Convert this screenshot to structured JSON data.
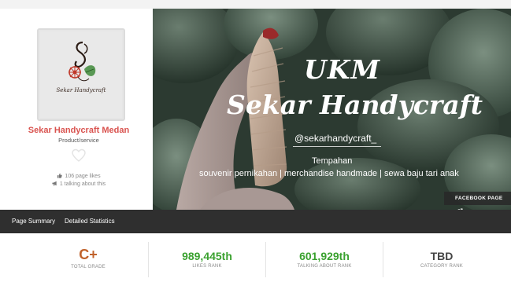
{
  "profile": {
    "logo_text": "Sekar Handycraft",
    "name": "Sekar Handycraft Medan",
    "category": "Product/service",
    "page_likes": "106 page likes",
    "talking_about": "1 talking about this"
  },
  "cover": {
    "title_line1": "UKM",
    "title_line2": "Sekar Handycraft",
    "handle": "@sekarhandycraft_",
    "line1": "Tempahan",
    "line2": "souvenir pernikahan | merchandise handmade | sewa baju tari anak",
    "facebook_button": "FACEBOOK PAGE"
  },
  "tabs": [
    {
      "label": "Page Summary"
    },
    {
      "label": "Detailed Statistics"
    }
  ],
  "metrics": [
    {
      "value": "C+",
      "label": "TOTAL GRADE",
      "color": "#c0622b"
    },
    {
      "value": "989,445th",
      "label": "LIKES RANK",
      "color": "#3aa12f"
    },
    {
      "value": "601,929th",
      "label": "TALKING ABOUT RANK",
      "color": "#3aa12f"
    },
    {
      "value": "TBD",
      "label": "CATEGORY RANK",
      "color": "#444444"
    }
  ],
  "icons": {
    "heart": "heart-icon",
    "like": "thumbs-up-icon",
    "talk": "megaphone-icon",
    "external": "external-link-icon"
  }
}
